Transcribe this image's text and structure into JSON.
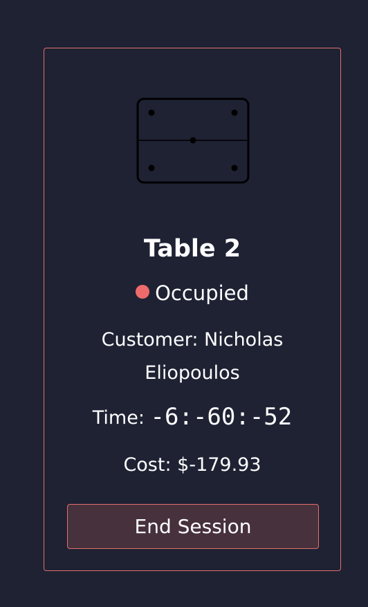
{
  "table_card": {
    "icon": "billiard-table-icon",
    "title": "Table 2",
    "status": {
      "label": "Occupied",
      "color": "#ef6b6b"
    },
    "customer": "Customer: Nicholas Eliopoulos",
    "time": {
      "label": "Time:",
      "value": "-6:-60:-52"
    },
    "cost": "Cost: $-179.93",
    "end_session_label": "End Session"
  },
  "colors": {
    "background": "#1e2233",
    "accent_border": "#e46f6c",
    "button_background": "#47313d"
  }
}
